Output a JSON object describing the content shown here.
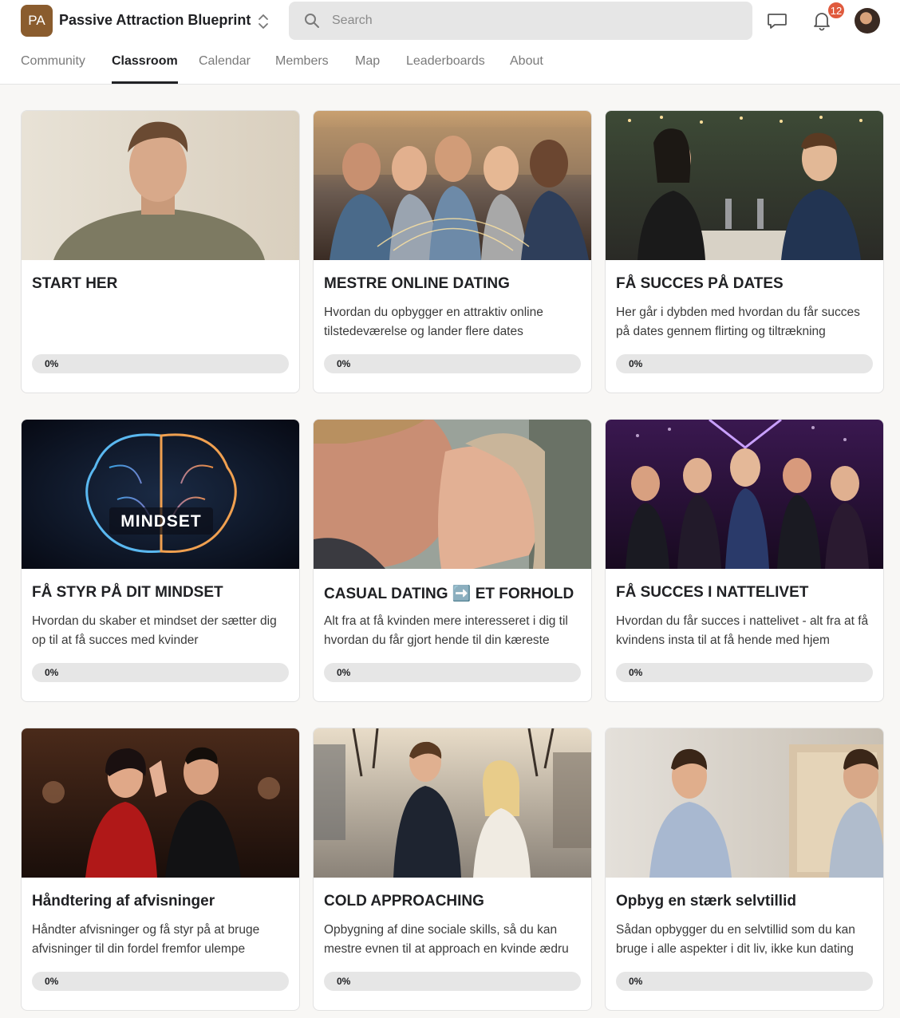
{
  "header": {
    "logo_initials": "PA",
    "app_name": "Passive Attraction Blueprint",
    "search_placeholder": "Search",
    "notification_count": "12",
    "icons": [
      "switcher-chevrons-icon",
      "search-icon",
      "chat-icon",
      "bell-icon"
    ]
  },
  "tabs": [
    {
      "label": "Community",
      "active": false
    },
    {
      "label": "Classroom",
      "active": true
    },
    {
      "label": "Calendar",
      "active": false
    },
    {
      "label": "Members",
      "active": false
    },
    {
      "label": "Map",
      "active": false
    },
    {
      "label": "Leaderboards",
      "active": false
    },
    {
      "label": "About",
      "active": false
    }
  ],
  "courses": [
    {
      "title": "START HER",
      "description": "",
      "progress": 0,
      "progress_label": "0%"
    },
    {
      "title": "MESTRE ONLINE DATING",
      "description": "Hvordan du opbygger en attraktiv online tilstedeværelse og lander flere dates",
      "progress": 0,
      "progress_label": "0%"
    },
    {
      "title": "FÅ SUCCES PÅ DATES",
      "description": "Her går i dybden med hvordan du får succes på dates gennem flirting og tiltrækning",
      "progress": 0,
      "progress_label": "0%"
    },
    {
      "title": "FÅ STYR PÅ DIT MINDSET",
      "description": "Hvordan du skaber et mindset der sætter dig op til at få succes med kvinder",
      "progress": 0,
      "progress_label": "0%",
      "image_text": "MINDSET"
    },
    {
      "title": "CASUAL DATING ➡️ ET FORHOLD",
      "description": "Alt fra at få kvinden mere interesseret i dig til hvordan du får gjort hende til din kæreste",
      "progress": 0,
      "progress_label": "0%"
    },
    {
      "title": "FÅ SUCCES I NATTELIVET",
      "description": "Hvordan du får succes i nattelivet - alt fra at få kvindens insta til at få hende med hjem",
      "progress": 0,
      "progress_label": "0%"
    },
    {
      "title": "Håndtering af afvisninger",
      "description": "Håndter afvisninger og få styr på at bruge afvisninger til din fordel fremfor ulempe",
      "progress": 0,
      "progress_label": "0%"
    },
    {
      "title": "COLD APPROACHING",
      "description": "Opbygning af dine sociale skills, så du kan mestre evnen til at approach en kvinde ædru",
      "progress": 0,
      "progress_label": "0%"
    },
    {
      "title": "Opbyg en stærk selvtillid",
      "description": "Sådan opbygger du en selvtillid som du kan bruge i alle aspekter i dit liv, ikke kun dating",
      "progress": 0,
      "progress_label": "0%"
    }
  ],
  "colors": {
    "logo_bg": "#8a5c2e",
    "badge": "#e05a3d",
    "progress_track": "#e6e6e6",
    "active_tab": "#202124"
  }
}
